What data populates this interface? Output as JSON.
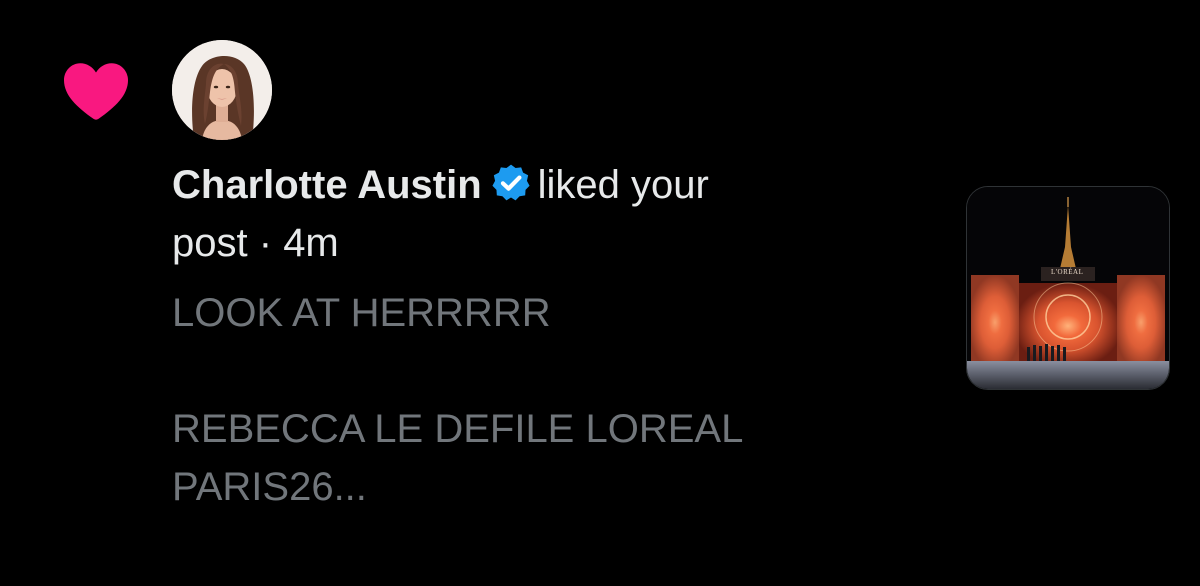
{
  "notification": {
    "icon": "heart-icon",
    "icon_color": "#f91880",
    "user": {
      "name": "Charlotte Austin",
      "verified": true,
      "verified_color": "#1d9bf0"
    },
    "action_text": "liked your",
    "post_word": "post",
    "separator": "·",
    "time": "4m",
    "post_excerpt": "LOOK AT HERRRRR\n\nREBECCA LE DEFILE LOREAL\nPARIS26...",
    "thumbnail": {
      "logo_text": "L'ORÉAL"
    }
  },
  "colors": {
    "background": "#000000",
    "primary_text": "#e7e9ea",
    "secondary_text": "#71767b"
  }
}
